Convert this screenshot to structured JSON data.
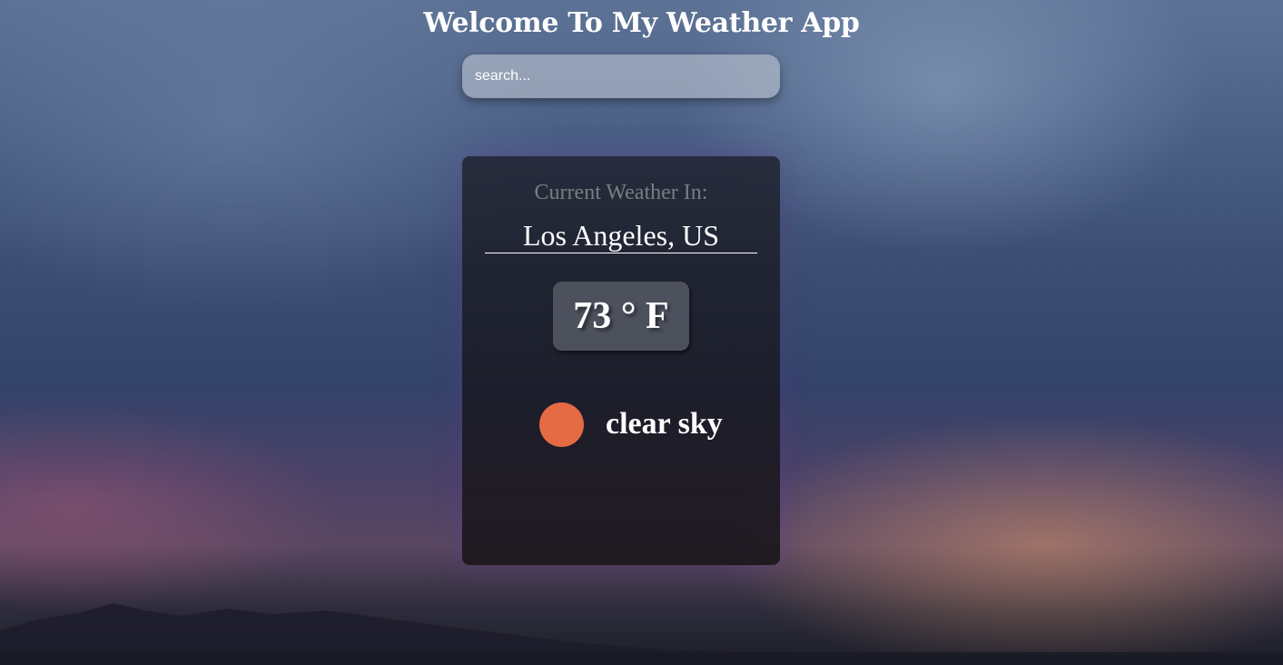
{
  "header": {
    "title": "Welcome To My Weather App"
  },
  "search": {
    "placeholder": "search...",
    "value": ""
  },
  "weather": {
    "subtitle": "Current Weather In:",
    "location": "Los Angeles, US",
    "temperature": "73 ° F",
    "condition": "clear sky",
    "condition_icon": "sun-icon",
    "condition_icon_color": "#e56b44"
  }
}
